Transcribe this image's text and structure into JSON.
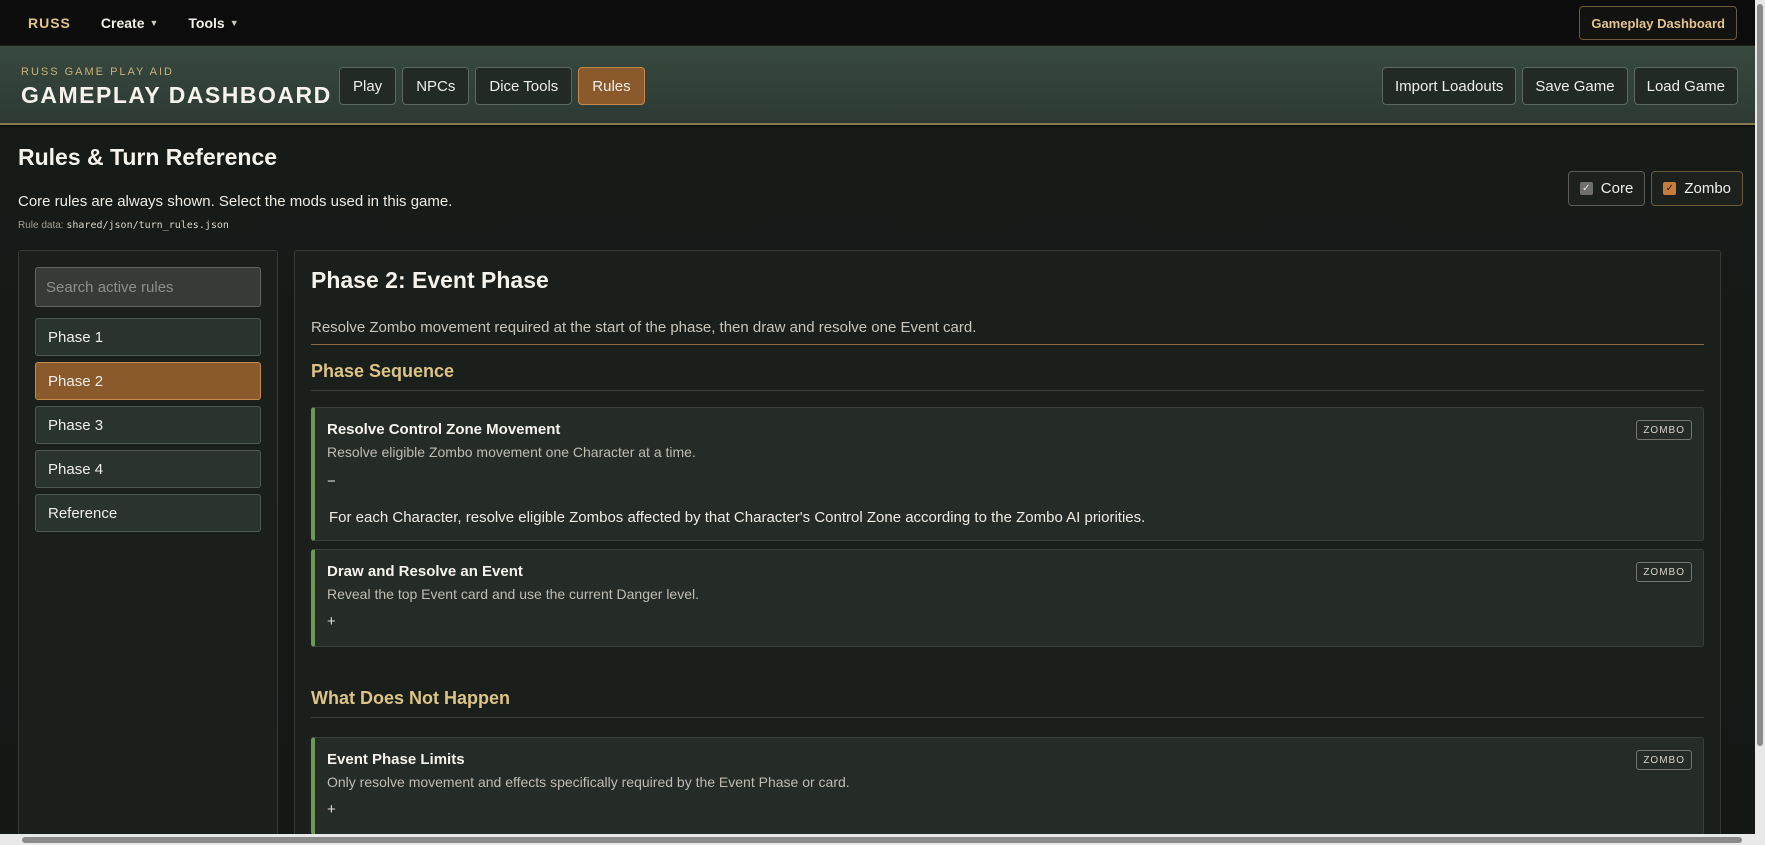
{
  "topnav": {
    "brand": "RUSS",
    "menus": [
      {
        "label": "Create"
      },
      {
        "label": "Tools"
      }
    ],
    "dashboard_button": "Gameplay Dashboard"
  },
  "header": {
    "eyebrow": "RUSS GAME PLAY AID",
    "title": "GAMEPLAY DASHBOARD",
    "tabs": [
      {
        "label": "Play"
      },
      {
        "label": "NPCs"
      },
      {
        "label": "Dice Tools"
      },
      {
        "label": "Rules"
      }
    ],
    "active_tab": "Rules",
    "actions": [
      {
        "label": "Import Loadouts"
      },
      {
        "label": "Save Game"
      },
      {
        "label": "Load Game"
      }
    ]
  },
  "rules": {
    "title": "Rules & Turn Reference",
    "subtitle": "Core rules are always shown. Select the mods used in this game.",
    "data_label": "Rule data:",
    "data_path": "shared/json/turn_rules.json",
    "mods": [
      {
        "label": "Core",
        "checked": true
      },
      {
        "label": "Zombo",
        "checked": true
      }
    ]
  },
  "sidebar": {
    "search_placeholder": "Search active rules",
    "items": [
      {
        "label": "Phase 1"
      },
      {
        "label": "Phase 2"
      },
      {
        "label": "Phase 3"
      },
      {
        "label": "Phase 4"
      },
      {
        "label": "Reference"
      }
    ],
    "active_item": "Phase 2"
  },
  "phase": {
    "title": "Phase 2: Event Phase",
    "description": "Resolve Zombo movement required at the start of the phase, then draw and resolve one Event card.",
    "sections": [
      {
        "heading": "Phase Sequence",
        "cards": [
          {
            "title": "Resolve Control Zone Movement",
            "subtitle": "Resolve eligible Zombo movement one Character at a time.",
            "badge": "ZOMBO",
            "toggle": "−",
            "expanded": true,
            "body": "For each Character, resolve eligible Zombos affected by that Character's Control Zone according to the Zombo AI priorities."
          },
          {
            "title": "Draw and Resolve an Event",
            "subtitle": "Reveal the top Event card and use the current Danger level.",
            "badge": "ZOMBO",
            "toggle": "+",
            "expanded": false
          }
        ]
      },
      {
        "heading": "What Does Not Happen",
        "cards": [
          {
            "title": "Event Phase Limits",
            "subtitle": "Only resolve movement and effects specifically required by the Event Phase or card.",
            "badge": "ZOMBO",
            "toggle": "+",
            "expanded": false
          }
        ]
      }
    ]
  },
  "colors": {
    "accent": "#8a5a2c",
    "gold": "#dcc386",
    "card_border": "#6b9a55",
    "header_bg": "#38493f"
  }
}
